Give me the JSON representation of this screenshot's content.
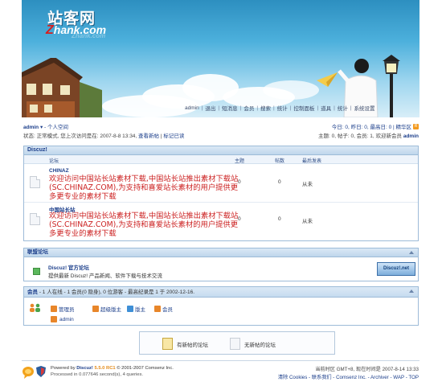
{
  "header": {
    "logo_cn": "站客网",
    "logo_en_z": "Z",
    "logo_en_rest": "hank.com",
    "logo_ghost": "Zhank.com",
    "nav": [
      "admin",
      "退出",
      "短消息",
      "会员",
      "搜索",
      "统计",
      "控制面板",
      "道具",
      "统计",
      "系统设置"
    ]
  },
  "userbar": {
    "username": "admin",
    "space_link": "个人空间",
    "status_prefix": "状态: 正常模式, 您上次访问是在: 2007-8-8 13:34,",
    "view_new": "查看新帖",
    "mark_read": "标记已读",
    "stats_line": "今日: 0, 昨日: 0, 最高日: 0 | 精华区",
    "topic_line": "主题: 0, 帖子: 0, 会员: 1, 欢迎新会员",
    "new_member": "admin",
    "rss": "R"
  },
  "forum": {
    "category": "Discuz!",
    "columns": {
      "forum": "论坛",
      "topics": "主题",
      "posts": "帖数",
      "last": "最后发表"
    },
    "rows": [
      {
        "name": "CHINAZ",
        "desc": "欢迎访问中国站长站素材下载,中国站长站推出素材下载站(SC.CHINAZ.COM),为支持和喜爱站长素材的用户提供更多更专业的素材下载",
        "topics": "0",
        "posts": "0",
        "last": "从未"
      },
      {
        "name": "中国站长站",
        "desc": "欢迎访问中国站长站素材下载,中国站长站推出素材下载站(SC.CHINAZ.COM),为支持和喜爱站长素材的用户提供更多更专业的素材下载",
        "topics": "0",
        "posts": "0",
        "last": "从未"
      }
    ]
  },
  "partners": {
    "title": "联盟论坛",
    "item_title": "Discuz! 官方论坛",
    "item_desc": "提供最新 Discuz! 产品新闻、软件下载与技术交流",
    "banner": "Discuz!.net"
  },
  "online": {
    "label": "会员",
    "summary": "- 1 人在线 - 1 会员(0 隐身), 0 位游客 - 最高纪录是 1 于 2002-12-16.",
    "legend": [
      "管理员",
      "超级版主",
      "版主",
      "会员"
    ],
    "legend_colors": [
      "#e8862a",
      "#e8862a",
      "#3e8fd6",
      "#e8862a"
    ],
    "online_user": "admin"
  },
  "legend_box": {
    "new_posts": "有新帖的论坛",
    "no_new": "无新帖的论坛"
  },
  "footer": {
    "powered_by": "Powered by",
    "product": "Discuz!",
    "version": "5.5.0 RC1",
    "copyright": "© 2001-2007 Comsenz Inc.",
    "processed": "Processed in 0.077646 second(s), 4 queries.",
    "time": "当前时区 GMT+8, 现在时间是 2007-8-14 13:33",
    "links": "清除 Cookies - 联系我们 - Comsenz Inc. - Archiver - WAP - TOP"
  }
}
